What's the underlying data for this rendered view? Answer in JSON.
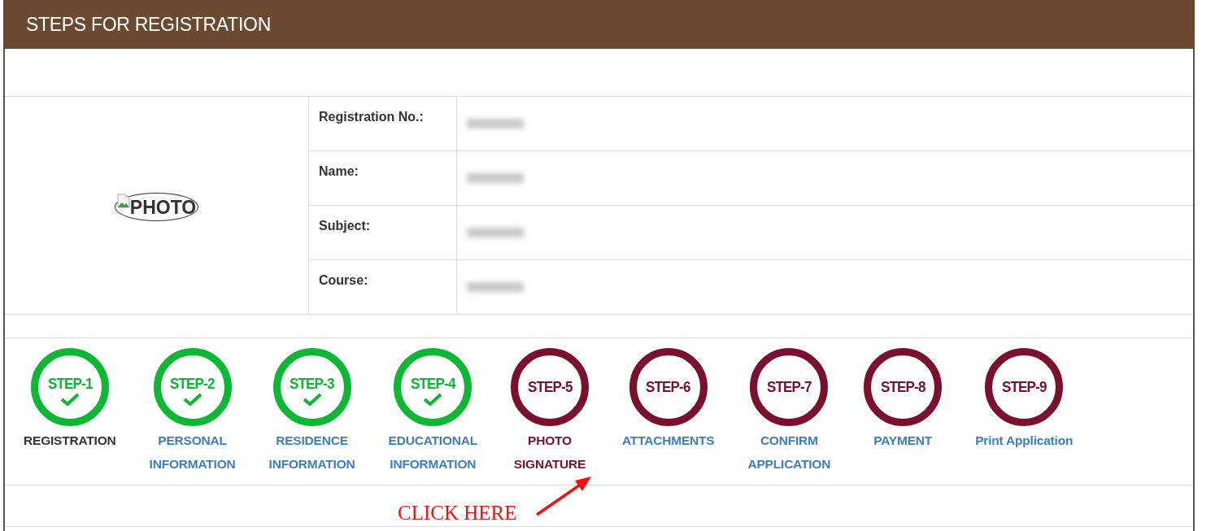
{
  "panel": {
    "title": "STEPS FOR REGISTRATION"
  },
  "photo": {
    "alt": "PHOTO"
  },
  "fields": [
    {
      "label": "Registration No.:",
      "redacted": true
    },
    {
      "label": "Name:",
      "redacted": true
    },
    {
      "label": "Subject:",
      "redacted": true
    },
    {
      "label": "Course:",
      "redacted": true
    }
  ],
  "steps": [
    {
      "badge": "STEP-1",
      "completed": true,
      "label": [
        "REGISTRATION"
      ],
      "color": "#333333"
    },
    {
      "badge": "STEP-2",
      "completed": true,
      "label": [
        "PERSONAL",
        "INFORMATION"
      ],
      "color": "#3a7fc1"
    },
    {
      "badge": "STEP-3",
      "completed": true,
      "label": [
        "RESIDENCE",
        "INFORMATION"
      ],
      "color": "#3a7fc1"
    },
    {
      "badge": "STEP-4",
      "completed": true,
      "label": [
        "EDUCATIONAL",
        "INFORMATION"
      ],
      "color": "#3a7fc1"
    },
    {
      "badge": "STEP-5",
      "completed": false,
      "label": [
        "PHOTO",
        "SIGNATURE"
      ],
      "color": "#7a0f2e"
    },
    {
      "badge": "STEP-6",
      "completed": false,
      "label": [
        "ATTACHMENTS"
      ],
      "color": "#3a7fc1"
    },
    {
      "badge": "STEP-7",
      "completed": false,
      "label": [
        "CONFIRM",
        "APPLICATION"
      ],
      "color": "#3a7fc1"
    },
    {
      "badge": "STEP-8",
      "completed": false,
      "label": [
        "PAYMENT"
      ],
      "color": "#3a7fc1"
    },
    {
      "badge": "STEP-9",
      "completed": false,
      "label": [
        "Print Application"
      ],
      "color": "#3a7fc1"
    }
  ],
  "annotation": {
    "text": "CLICK HERE"
  }
}
